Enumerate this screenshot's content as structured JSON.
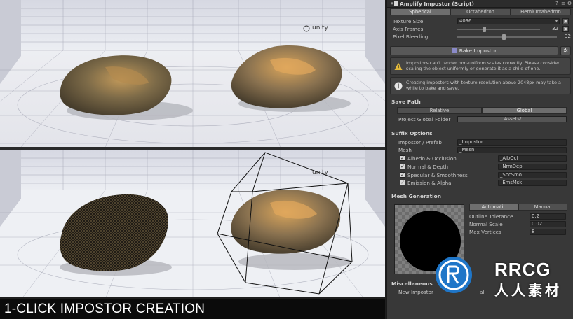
{
  "caption": "1-CLICK IMPOSTOR CREATION",
  "viewport": {
    "brand_label": "unity",
    "accent_ground": "#e8eaef",
    "grid_line": "#8c8ea0"
  },
  "inspector": {
    "title": "Amplify Impostor (Script)",
    "tabs": [
      "Spherical",
      "Octahedron",
      "HemiOctahedron"
    ],
    "active_tab": "Spherical",
    "texture_size": {
      "label": "Texture Size",
      "value": "4096"
    },
    "axis_frames": {
      "label": "Axis Frames",
      "value": "32"
    },
    "pixel_bleeding": {
      "label": "Pixel Bleeding",
      "value": "32"
    },
    "bake_button": "Bake Impostor",
    "warning_text": "Impostors can't render non-uniform scales correctly. Please consider scaling the object uniformly or generate it as a child of one.",
    "info_text": "Creating impostors with texture resolution above 2048px may take a while to bake and save.",
    "save_path": {
      "header": "Save Path",
      "options": [
        "Relative",
        "Global"
      ],
      "active": "Global",
      "folder_label": "Project Global Folder",
      "folder_value": "Assets/"
    },
    "suffix_options": {
      "header": "Suffix Options",
      "impostor_prefab_label": "Impostor / Prefab",
      "impostor_prefab_value": "_Impostor",
      "mesh_label": "Mesh",
      "mesh_value": "_Mesh",
      "items": [
        {
          "label": "Albedo & Occlusion",
          "value": "_AlbOcl",
          "checked": true
        },
        {
          "label": "Normal & Depth",
          "value": "_NrmDep",
          "checked": true
        },
        {
          "label": "Specular & Smoothness",
          "value": "_SpcSmo",
          "checked": true
        },
        {
          "label": "Emission & Alpha",
          "value": "_EmsMsk",
          "checked": true
        }
      ]
    },
    "mesh_generation": {
      "header": "Mesh Generation",
      "modes": [
        "Automatic",
        "Manual"
      ],
      "active": "Automatic",
      "outline_tolerance_label": "Outline Tolerance",
      "outline_tolerance_value": "0.2",
      "normal_scale_label": "Normal Scale",
      "normal_scale_value": "0.02",
      "max_vertices_label": "Max Vertices",
      "max_vertices_value": "8"
    },
    "miscellaneous": {
      "header": "Miscellaneous",
      "new_impostor_label": "New Impostor",
      "new_impostor_suffix": "al"
    }
  },
  "watermark": {
    "brand": "RRCG",
    "subtitle": "人人素材"
  }
}
